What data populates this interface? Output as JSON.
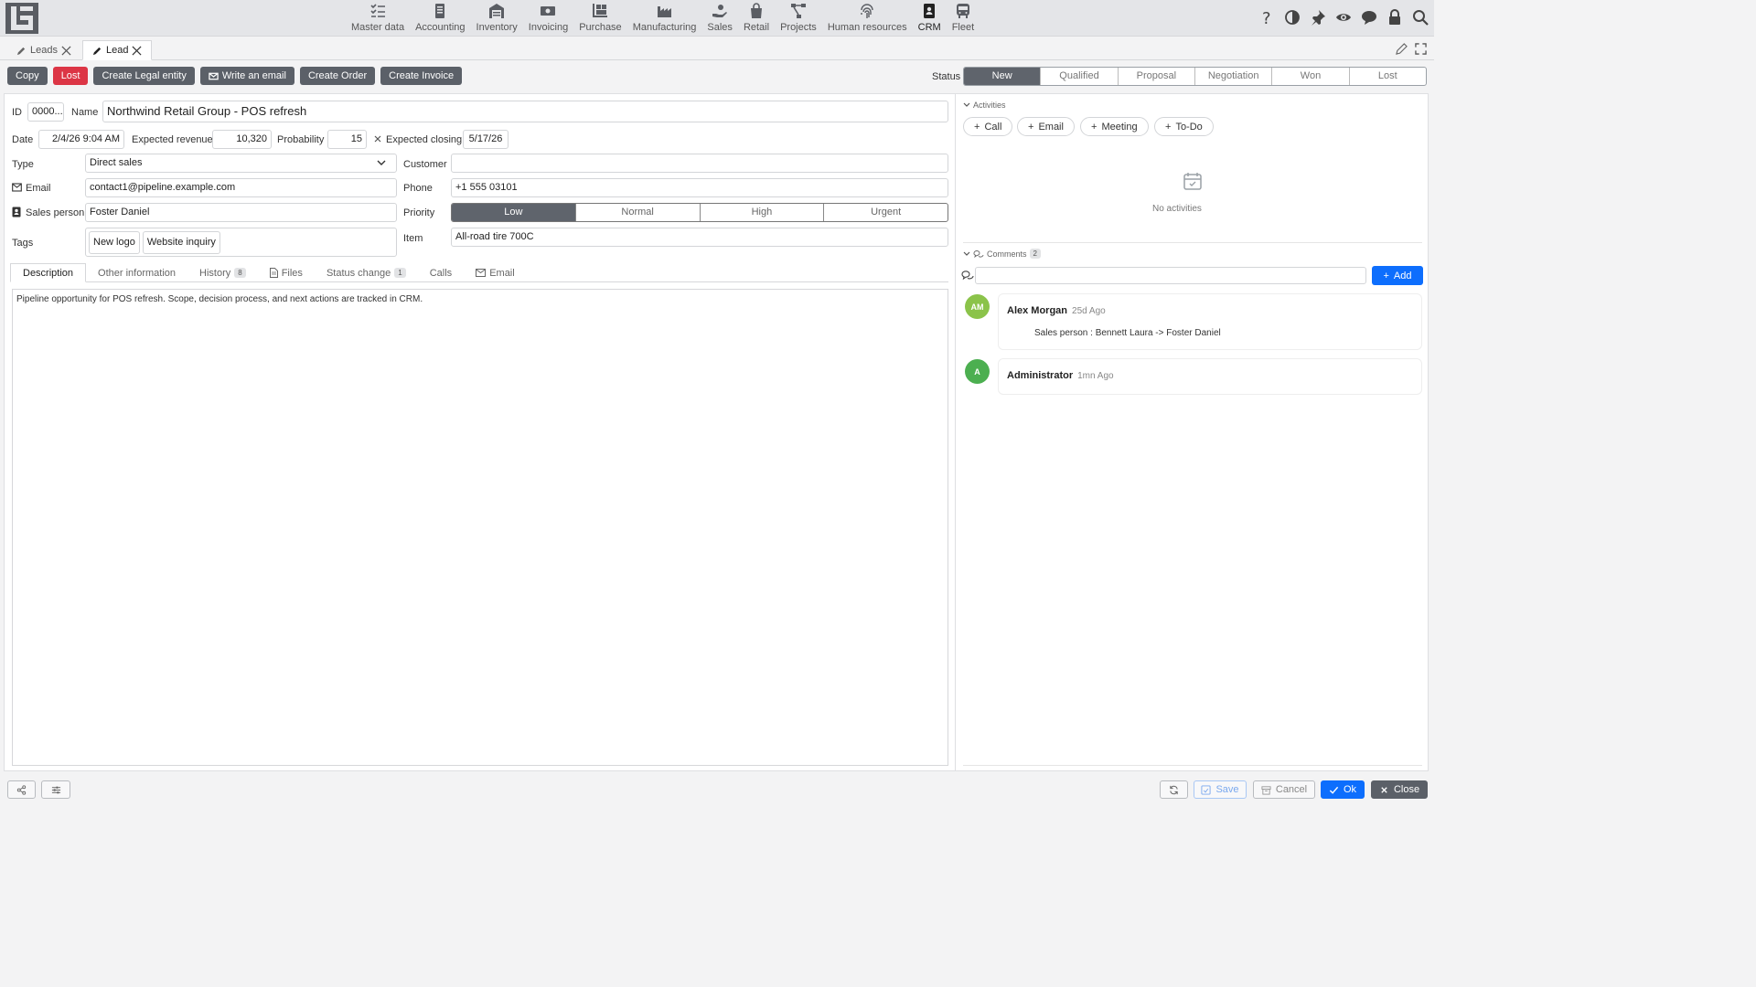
{
  "nav": [
    {
      "label": "Master data",
      "icon": "list-check-icon"
    },
    {
      "label": "Accounting",
      "icon": "ledger-icon"
    },
    {
      "label": "Inventory",
      "icon": "warehouse-icon"
    },
    {
      "label": "Invoicing",
      "icon": "cash-icon"
    },
    {
      "label": "Purchase",
      "icon": "dolly-icon"
    },
    {
      "label": "Manufacturing",
      "icon": "factory-icon"
    },
    {
      "label": "Sales",
      "icon": "hand-coin-icon"
    },
    {
      "label": "Retail",
      "icon": "shopping-bag-icon"
    },
    {
      "label": "Projects",
      "icon": "diagram-icon"
    },
    {
      "label": "Human resources",
      "icon": "fingerprint-icon"
    },
    {
      "label": "CRM",
      "icon": "contact-book-icon"
    },
    {
      "label": "Fleet",
      "icon": "bus-icon"
    }
  ],
  "doc_tabs": {
    "leads": "Leads",
    "lead": "Lead"
  },
  "actions": {
    "copy": "Copy",
    "lost": "Lost",
    "create_legal": "Create Legal entity",
    "write_email": "Write an email",
    "create_order": "Create Order",
    "create_invoice": "Create Invoice"
  },
  "status": {
    "label": "Status",
    "options": [
      "New",
      "Qualified",
      "Proposal",
      "Negotiation",
      "Won",
      "Lost"
    ],
    "selected": "New"
  },
  "form": {
    "id_label": "ID",
    "id_value": "0000...",
    "name_label": "Name",
    "name_value": "Northwind Retail Group - POS refresh",
    "date_label": "Date",
    "date_value": "2/4/26 9:04 AM",
    "revenue_label": "Expected revenue",
    "revenue_value": "10,320",
    "prob_label": "Probability",
    "prob_value": "15",
    "closing_label": "Expected closing",
    "closing_value": "5/17/26",
    "type_label": "Type",
    "type_value": "Direct sales",
    "customer_label": "Customer",
    "customer_value": "",
    "email_label": "Email",
    "email_value": "contact1@pipeline.example.com",
    "phone_label": "Phone",
    "phone_value": "+1 555 03101",
    "sales_label": "Sales person",
    "sales_value": "Foster Daniel",
    "priority_label": "Priority",
    "priority_options": [
      "Low",
      "Normal",
      "High",
      "Urgent"
    ],
    "priority_selected": "Low",
    "tags_label": "Tags",
    "tags": [
      "New logo",
      "Website inquiry"
    ],
    "item_label": "Item",
    "item_value": "All-road tire 700C"
  },
  "subtabs": {
    "description": "Description",
    "other": "Other information",
    "history": "History",
    "history_count": "8",
    "files": "Files",
    "status_change": "Status change",
    "status_count": "1",
    "calls": "Calls",
    "email": "Email"
  },
  "description": "Pipeline opportunity for POS refresh. Scope, decision process, and next actions are tracked in CRM.",
  "activities": {
    "title": "Activities",
    "call": "Call",
    "email": "Email",
    "meeting": "Meeting",
    "todo": "To-Do",
    "empty": "No activities"
  },
  "comments": {
    "title": "Comments",
    "count": "2",
    "add": "Add",
    "items": [
      {
        "initials": "AM",
        "author": "Alex Morgan",
        "time": "25d Ago",
        "text": "Sales person : Bennett Laura -> Foster Daniel",
        "color": "#8bc34a"
      },
      {
        "initials": "A",
        "author": "Administrator",
        "time": "1mn Ago",
        "text": "",
        "color": "#4caf50"
      }
    ]
  },
  "footer": {
    "save": "Save",
    "cancel": "Cancel",
    "ok": "Ok",
    "close": "Close"
  },
  "colors": {
    "primary": "#0d6efd",
    "danger": "#dc3545",
    "dark": "#5b6068"
  }
}
